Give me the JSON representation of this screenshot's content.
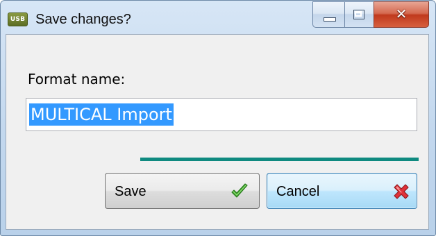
{
  "window": {
    "title": "Save changes?",
    "app_icon_text": "USB"
  },
  "dialog": {
    "field_label": "Format name:",
    "format_name_value": "MULTICAL Import",
    "separator_color": "#0f8a80"
  },
  "buttons": {
    "save_label": "Save",
    "save_icon": "checkmark-icon",
    "cancel_label": "Cancel",
    "cancel_icon": "red-x-icon"
  }
}
